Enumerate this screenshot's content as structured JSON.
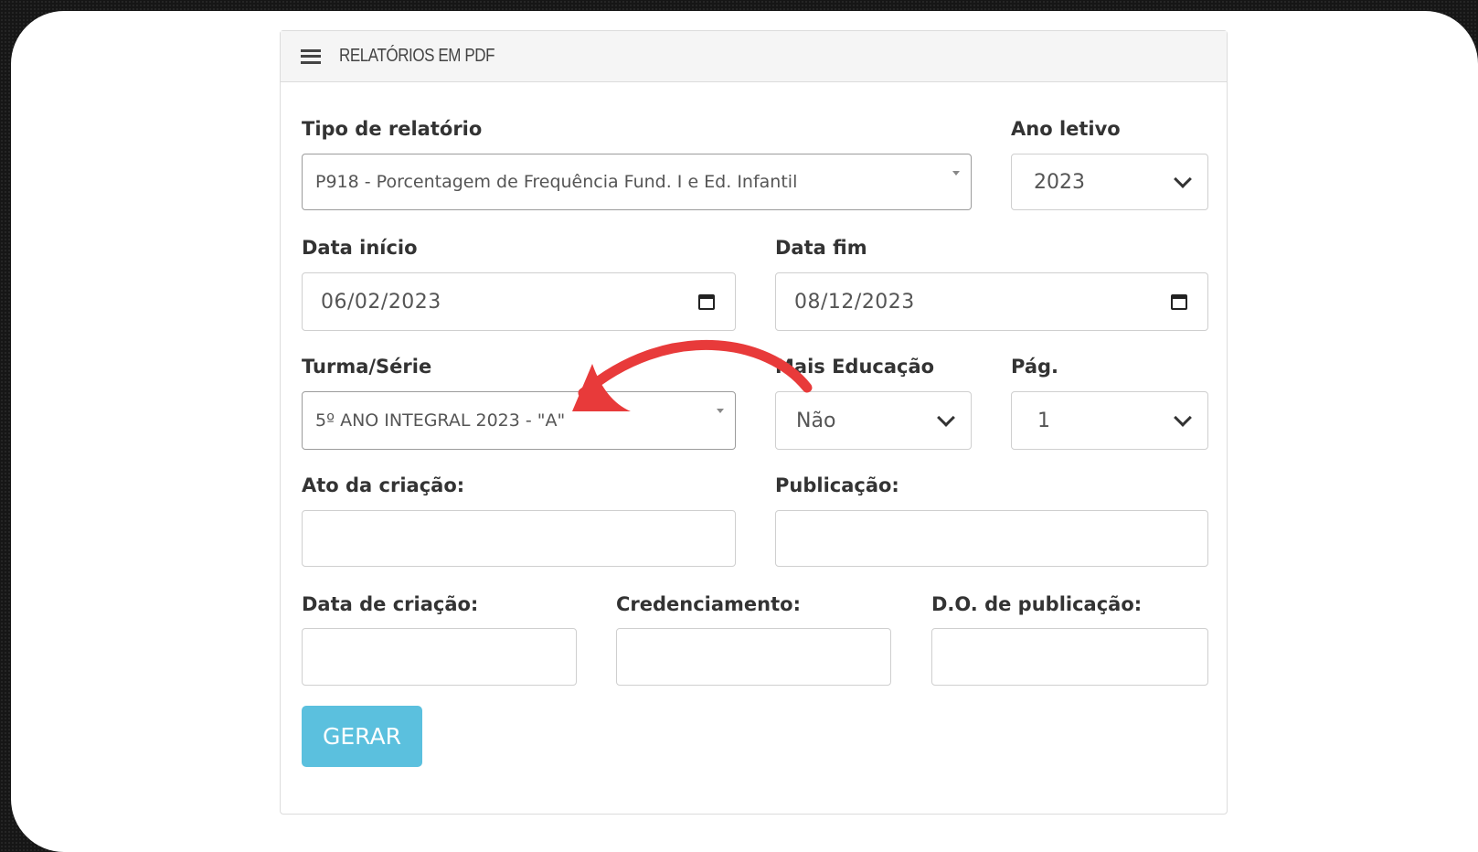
{
  "header": {
    "title": "RELATÓRIOS EM PDF",
    "icon": "list-icon"
  },
  "form": {
    "tipo_relatorio": {
      "label": "Tipo de relatório",
      "value": "P918 - Porcentagem de Frequência Fund. I e Ed. Infantil"
    },
    "ano_letivo": {
      "label": "Ano letivo",
      "value": "2023"
    },
    "data_inicio": {
      "label": "Data início",
      "value": "06/02/2023"
    },
    "data_fim": {
      "label": "Data fim",
      "value": "08/12/2023"
    },
    "turma_serie": {
      "label": "Turma/Série",
      "value": "5º ANO INTEGRAL 2023 - \"A\""
    },
    "mais_educacao": {
      "label": "Mais Educação",
      "value": "Não"
    },
    "pag": {
      "label": "Pág.",
      "value": "1"
    },
    "ato_criacao": {
      "label": "Ato da criação:",
      "value": ""
    },
    "publicacao": {
      "label": "Publicação:",
      "value": ""
    },
    "data_criacao": {
      "label": "Data de criação:",
      "value": ""
    },
    "credenciamento": {
      "label": "Credenciamento:",
      "value": ""
    },
    "do_publicacao": {
      "label": "D.O. de publicação:",
      "value": ""
    },
    "submit_label": "GERAR"
  },
  "colors": {
    "button": "#5bc0de",
    "arrow": "#e83a3a",
    "background": "#161616"
  }
}
